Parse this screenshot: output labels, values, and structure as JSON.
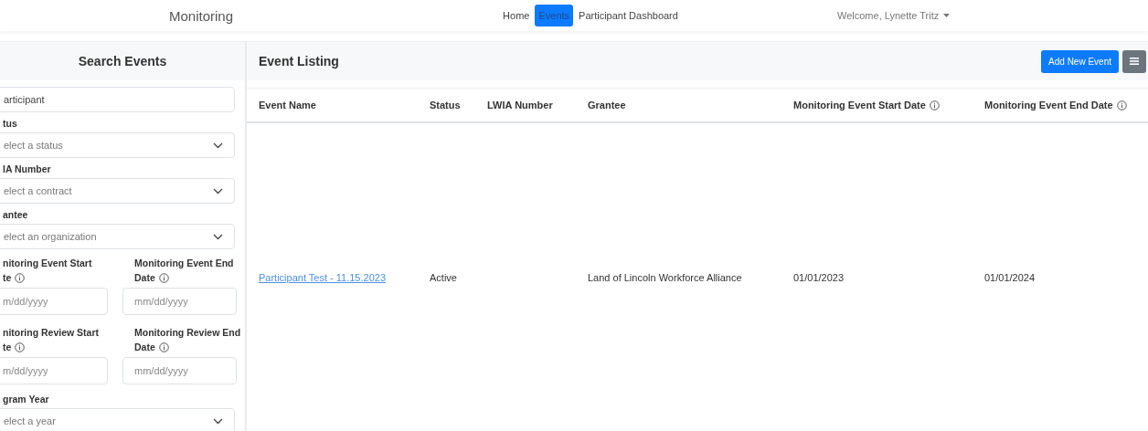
{
  "navbar": {
    "brand": "Monitoring",
    "links": [
      {
        "label": "Home",
        "selected": false
      },
      {
        "label": "Events",
        "selected": true
      },
      {
        "label": "Participant Dashboard",
        "selected": false
      }
    ],
    "user_menu": "Welcome, Lynette Tritz"
  },
  "search_panel": {
    "title": "Search Events",
    "fields": [
      {
        "kind": "text",
        "value": "articipant"
      },
      {
        "kind": "select",
        "label_lines": [
          "tus"
        ],
        "placeholder": "elect a status"
      },
      {
        "kind": "select",
        "label_lines": [
          "IA Number"
        ],
        "placeholder": "elect a contract"
      },
      {
        "kind": "select",
        "label_lines": [
          "antee"
        ],
        "placeholder": "elect an organization"
      },
      {
        "kind": "date_pair",
        "items": [
          {
            "label_lines": [
              "nitoring Event Start",
              "te"
            ],
            "placeholder": "m/dd/yyyy"
          },
          {
            "label_lines": [
              "Monitoring Event End",
              "Date"
            ],
            "placeholder": "mm/dd/yyyy"
          }
        ]
      },
      {
        "kind": "date_pair",
        "items": [
          {
            "label_lines": [
              "nitoring Review Start",
              "te"
            ],
            "placeholder": "m/dd/yyyy"
          },
          {
            "label_lines": [
              "Monitoring Review End",
              "Date"
            ],
            "placeholder": "mm/dd/yyyy"
          }
        ]
      },
      {
        "kind": "select",
        "label_lines": [
          "gram Year"
        ],
        "placeholder": "elect a year"
      }
    ]
  },
  "listing": {
    "title": "Event Listing",
    "add_button": "Add New Event",
    "columns": [
      {
        "label": "Event Name",
        "info": false
      },
      {
        "label": "Status",
        "info": false
      },
      {
        "label": "LWIA Number",
        "info": false
      },
      {
        "label": "Grantee",
        "info": false
      },
      {
        "label": "Monitoring Event Start Date",
        "info": true
      },
      {
        "label": "Monitoring Event End Date",
        "info": true
      }
    ],
    "rows": [
      {
        "cells": [
          {
            "kind": "link",
            "text": "Participant Test - 11.15.2023"
          },
          {
            "kind": "text",
            "text": "Active"
          },
          {
            "kind": "empty"
          },
          {
            "kind": "text",
            "text": "Land of Lincoln Workforce Alliance"
          },
          {
            "kind": "text",
            "text": "01/01/2023"
          },
          {
            "kind": "text",
            "text": "01/01/2024"
          }
        ]
      }
    ]
  }
}
